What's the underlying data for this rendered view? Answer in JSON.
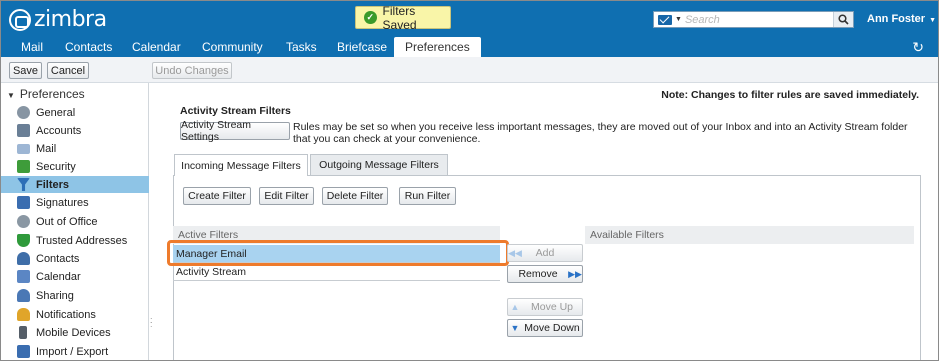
{
  "app": {
    "logo_text": "zimbra"
  },
  "toast": {
    "text": "Filters Saved"
  },
  "search": {
    "placeholder": "Search"
  },
  "user": {
    "name": "Ann Foster"
  },
  "app_tabs": [
    "Mail",
    "Contacts",
    "Calendar",
    "Community",
    "Tasks",
    "Briefcase",
    "Preferences"
  ],
  "active_app_tab": "Preferences",
  "toolbar": {
    "save": "Save",
    "cancel": "Cancel",
    "undo": "Undo Changes"
  },
  "nav": {
    "heading": "Preferences",
    "items": [
      {
        "label": "General",
        "icon": "gear-icon",
        "color": "#7a8a99"
      },
      {
        "label": "Accounts",
        "icon": "accounts-icon",
        "color": "#6a7f96"
      },
      {
        "label": "Mail",
        "icon": "mail-icon",
        "color": "#7b9ac0"
      },
      {
        "label": "Security",
        "icon": "security-icon",
        "color": "#3e9c3a"
      },
      {
        "label": "Filters",
        "icon": "filter-icon",
        "color": "#2d6fb7"
      },
      {
        "label": "Signatures",
        "icon": "signature-icon",
        "color": "#3a6db0"
      },
      {
        "label": "Out of Office",
        "icon": "out-of-office-icon",
        "color": "#7a8a99"
      },
      {
        "label": "Trusted Addresses",
        "icon": "shield-icon",
        "color": "#2f9a3b"
      },
      {
        "label": "Contacts",
        "icon": "contacts-icon",
        "color": "#3f6ea8"
      },
      {
        "label": "Calendar",
        "icon": "calendar-icon",
        "color": "#5b86c4"
      },
      {
        "label": "Sharing",
        "icon": "sharing-icon",
        "color": "#4a78b5"
      },
      {
        "label": "Notifications",
        "icon": "bell-icon",
        "color": "#e0a52a"
      },
      {
        "label": "Mobile Devices",
        "icon": "mobile-icon",
        "color": "#555e68"
      },
      {
        "label": "Import / Export",
        "icon": "import-export-icon",
        "color": "#3a6db0"
      }
    ],
    "selected": "Filters"
  },
  "content": {
    "note": "Note: Changes to filter rules are saved immediately.",
    "section_title": "Activity Stream Filters",
    "settings_button": "Activity Stream Settings",
    "description": "Rules may be set so when you receive less important messages, they are moved out of your Inbox and into an Activity Stream folder that you can check at your convenience.",
    "tabs": [
      "Incoming Message Filters",
      "Outgoing Message Filters"
    ],
    "filter_buttons": [
      "Create Filter",
      "Edit Filter",
      "Delete Filter",
      "Run Filter"
    ],
    "active_filters_header": "Active Filters",
    "available_filters_header": "Available Filters",
    "active_filters": [
      "Manager Email",
      "Activity Stream"
    ],
    "selected_filter": "Manager Email",
    "actions": {
      "add": "Add",
      "remove": "Remove",
      "move_up": "Move Up",
      "move_down": "Move Down"
    }
  },
  "colors": {
    "brand": "#0f6fb1",
    "selection": "#a9d3f0",
    "highlight": "#ee7b2c"
  }
}
